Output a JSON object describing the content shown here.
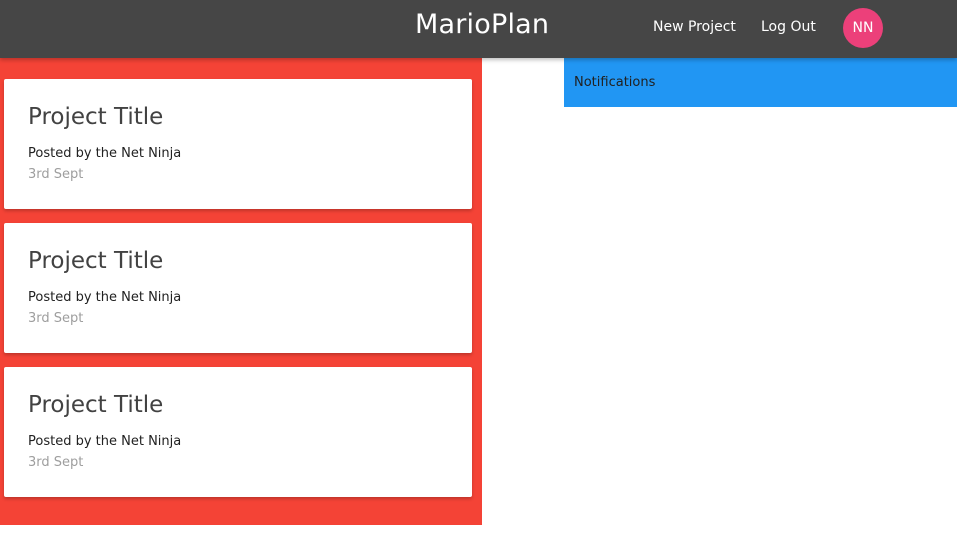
{
  "navbar": {
    "brand": "MarioPlan",
    "links": [
      "New Project",
      "Log Out"
    ],
    "avatar_initials": "NN",
    "avatar_color": "#ec407a",
    "background": "#464646"
  },
  "projects": [
    {
      "title": "Project Title",
      "author": "Posted by the Net Ninja",
      "date": "3rd Sept"
    },
    {
      "title": "Project Title",
      "author": "Posted by the Net Ninja",
      "date": "3rd Sept"
    },
    {
      "title": "Project Title",
      "author": "Posted by the Net Ninja",
      "date": "3rd Sept"
    }
  ],
  "project_panel_color": "#f44336",
  "notifications": {
    "title": "Notifications",
    "color": "#2196f3"
  }
}
